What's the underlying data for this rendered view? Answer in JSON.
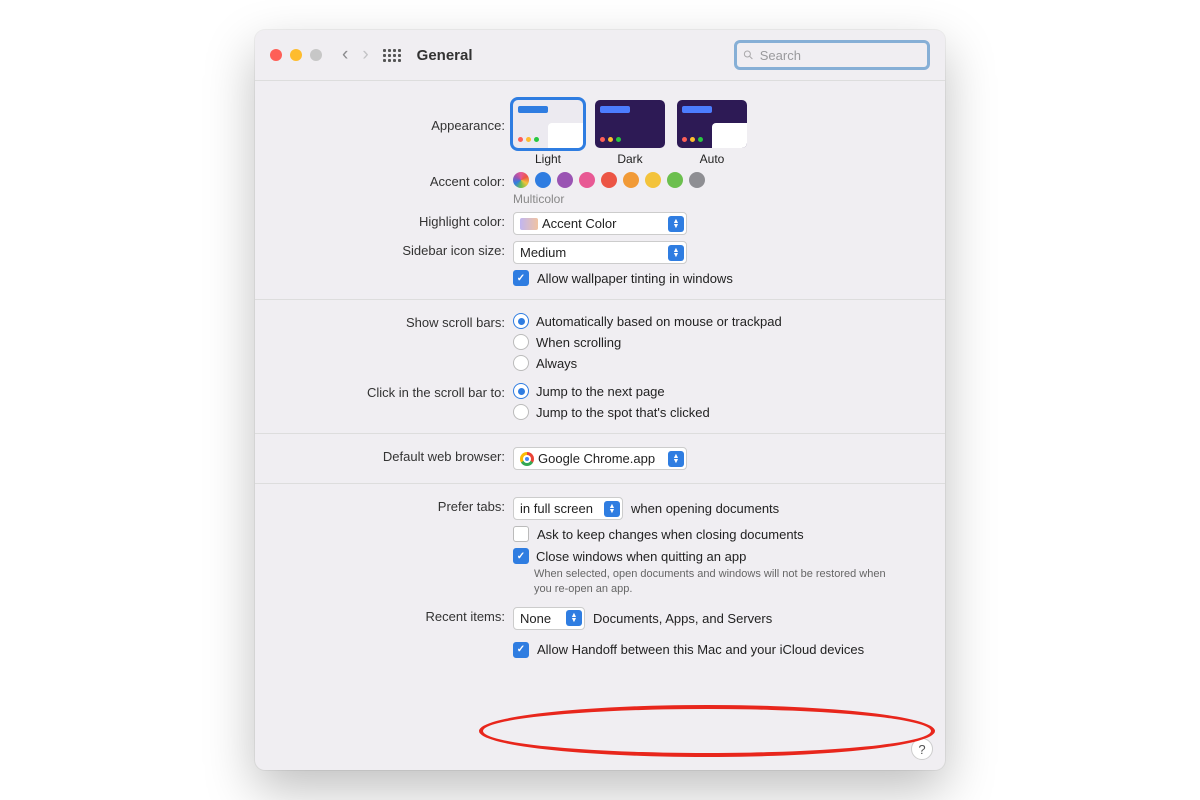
{
  "traffic": {
    "close": "#fe5f57",
    "min": "#febc2e",
    "max": "#c7c7c7"
  },
  "title": "General",
  "search": {
    "placeholder": "Search"
  },
  "appearance": {
    "label": "Appearance:",
    "options": [
      "Light",
      "Dark",
      "Auto"
    ],
    "selected": "Light"
  },
  "accent": {
    "label": "Accent color:",
    "selected_label": "Multicolor",
    "colors": [
      "multicolor",
      "#2f7de1",
      "#9a54b3",
      "#e85994",
      "#ec5545",
      "#f19a37",
      "#f3c33b",
      "#6cbf4e",
      "#8e8e93"
    ]
  },
  "highlight": {
    "label": "Highlight color:",
    "value": "Accent Color"
  },
  "sidebar_size": {
    "label": "Sidebar icon size:",
    "value": "Medium"
  },
  "wallpaper_tint": {
    "checked": true,
    "label": "Allow wallpaper tinting in windows"
  },
  "scrollbars": {
    "label": "Show scroll bars:",
    "options": [
      "Automatically based on mouse or trackpad",
      "When scrolling",
      "Always"
    ],
    "selected": 0
  },
  "click_scroll": {
    "label": "Click in the scroll bar to:",
    "options": [
      "Jump to the next page",
      "Jump to the spot that's clicked"
    ],
    "selected": 0
  },
  "browser": {
    "label": "Default web browser:",
    "value": "Google Chrome.app"
  },
  "tabs": {
    "label": "Prefer tabs:",
    "value": "in full screen",
    "suffix": "when opening documents"
  },
  "ask_keep": {
    "checked": false,
    "label": "Ask to keep changes when closing documents"
  },
  "close_windows": {
    "checked": true,
    "label": "Close windows when quitting an app",
    "desc": "When selected, open documents and windows will not be restored when you re-open an app."
  },
  "recent": {
    "label": "Recent items:",
    "value": "None",
    "suffix": "Documents, Apps, and Servers"
  },
  "handoff": {
    "checked": true,
    "label": "Allow Handoff between this Mac and your iCloud devices"
  },
  "help": "?"
}
